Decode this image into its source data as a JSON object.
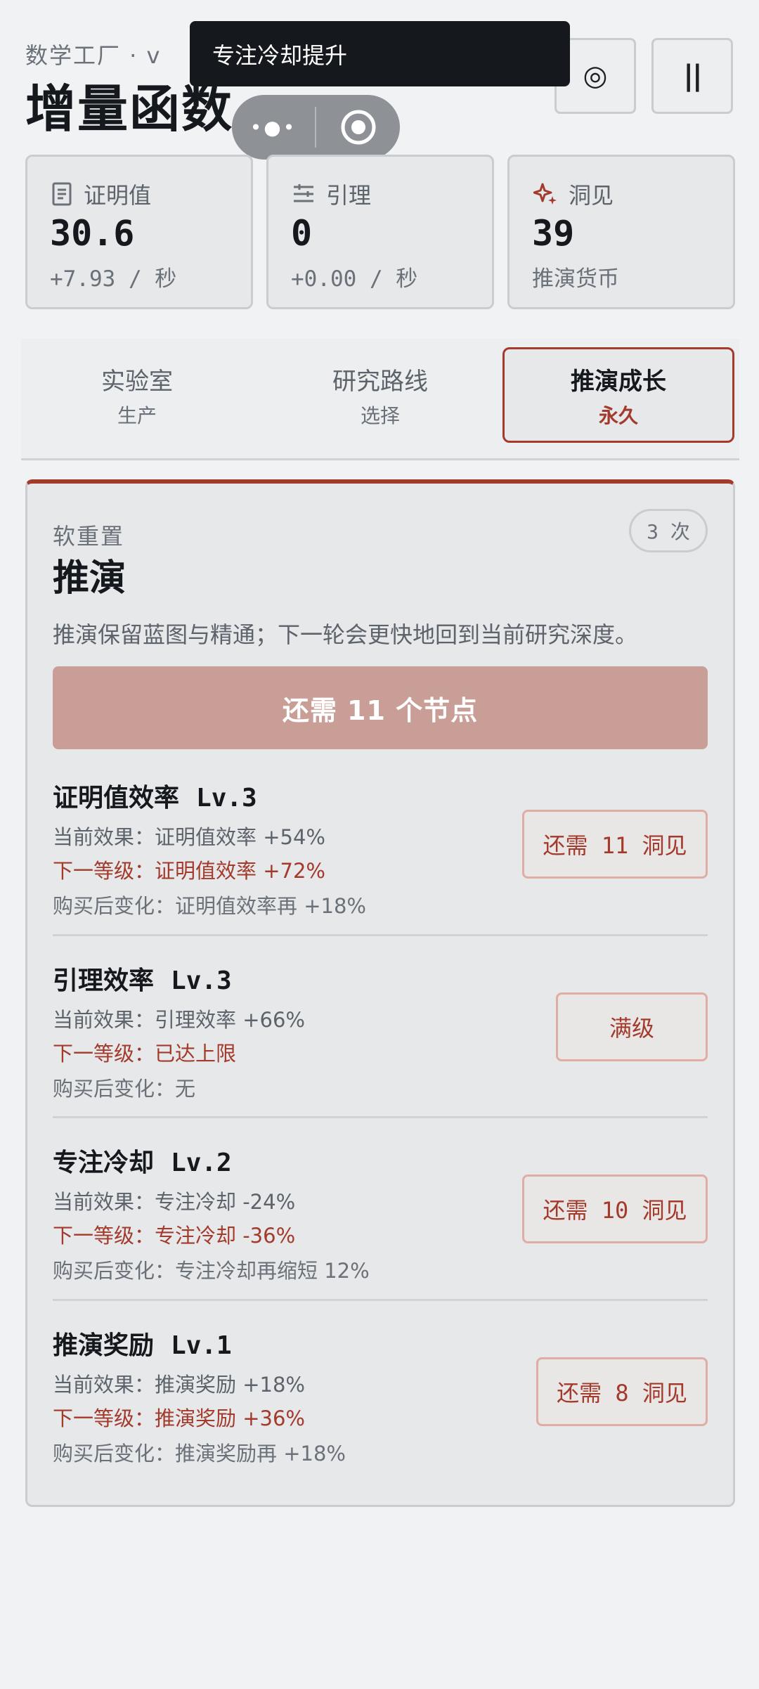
{
  "header": {
    "subtitle": "数学工厂 · v",
    "title": "增量函数",
    "settings_icon": "◎",
    "pause_icon": "||"
  },
  "toast": {
    "text": "专注冷却提升"
  },
  "capsule": {
    "more_icon": "•●•"
  },
  "stats": [
    {
      "label": "证明值",
      "value": "30.6",
      "rate": "+7.93 / 秒",
      "icon": "document-icon"
    },
    {
      "label": "引理",
      "value": "0",
      "rate": "+0.00 / 秒",
      "icon": "sliders-icon"
    },
    {
      "label": "洞见",
      "value": "39",
      "rate": "推演货币",
      "icon": "sparkle-icon"
    }
  ],
  "tabs": [
    {
      "label": "实验室",
      "sub": "生产"
    },
    {
      "label": "研究路线",
      "sub": "选择"
    },
    {
      "label": "推演成长",
      "sub": "永久"
    }
  ],
  "panel": {
    "kicker": "软重置",
    "title": "推演",
    "count": "3 次",
    "description": "推演保留蓝图与精通；下一轮会更快地回到当前研究深度。",
    "action_label": "还需 11 个节点"
  },
  "upgrades": [
    {
      "name": "证明值效率",
      "level": "Lv.3",
      "current": "当前效果：证明值效率 +54%",
      "next": "下一等级：证明值效率 +72%",
      "change": "购买后变化：证明值效率再 +18%",
      "button": "还需 11 洞见"
    },
    {
      "name": "引理效率",
      "level": "Lv.3",
      "current": "当前效果：引理效率 +66%",
      "next": "下一等级：已达上限",
      "change": "购买后变化：无",
      "button": "满级"
    },
    {
      "name": "专注冷却",
      "level": "Lv.2",
      "current": "当前效果：专注冷却 -24%",
      "next": "下一等级：专注冷却 -36%",
      "change": "购买后变化：专注冷却再缩短 12%",
      "button": "还需 10 洞见"
    },
    {
      "name": "推演奖励",
      "level": "Lv.1",
      "current": "当前效果：推演奖励 +18%",
      "next": "下一等级：推演奖励 +36%",
      "change": "购买后变化：推演奖励再 +18%",
      "button": "还需 8 洞见"
    }
  ],
  "colors": {
    "accent": "#a33a2c",
    "action_disabled": "#c89e97",
    "background": "#f1f2f4"
  }
}
